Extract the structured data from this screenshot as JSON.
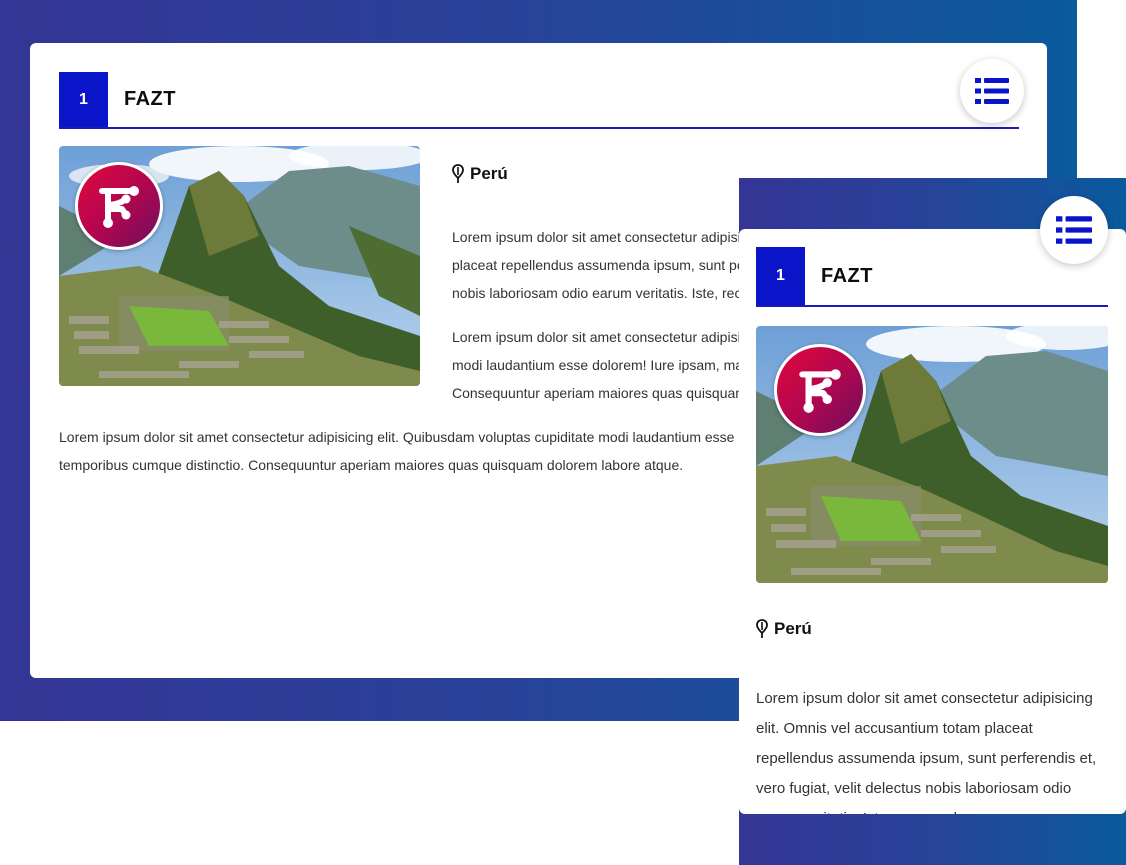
{
  "colors": {
    "gradient_start": "#353596",
    "gradient_end": "#0a5a9d",
    "accent": "#0a14c8",
    "logo_red": "#e0083c",
    "logo_purple": "#6d0f5c"
  },
  "desktop": {
    "number": "1",
    "brand": "FAZT",
    "menu_icon": "list-icon",
    "location_icon": "map-pin-icon",
    "location": "Perú",
    "paragraphs": [
      "Lorem ipsum dolor sit amet consectetur adipisicing elit. Omnis vel accusantium totam placeat repellendus assumenda ipsum, sunt perferendis et, vero fugiat, velit delectus nobis laboriosam odio earum veritatis. Iste, recusandae.",
      "Lorem ipsum dolor sit amet consectetur adipisicing elit. Quibusdam voluptas cupiditate modi laudantium esse dolorem! Iure ipsam, magni aliquid temporibus cumque distinctio. Consequuntur aperiam maiores quas quisquam dolorem labore atque.",
      "Lorem ipsum dolor sit amet consectetur adipisicing elit. Quibusdam voluptas cupiditate modi laudantium esse dolorem! Iure ipsam, magni aliquid temporibus cumque distinctio. Consequuntur aperiam maiores quas quisquam dolorem labore atque."
    ]
  },
  "mobile": {
    "number": "1",
    "brand": "FAZT",
    "menu_icon": "list-icon",
    "location_icon": "map-pin-icon",
    "location": "Perú",
    "paragraph": "Lorem ipsum dolor sit amet consectetur adipisicing elit. Omnis vel accusantium totam placeat repellendus assumenda ipsum, sunt perferendis et, vero fugiat, velit delectus nobis laboriosam odio earum veritatis. Iste, recusandae."
  }
}
